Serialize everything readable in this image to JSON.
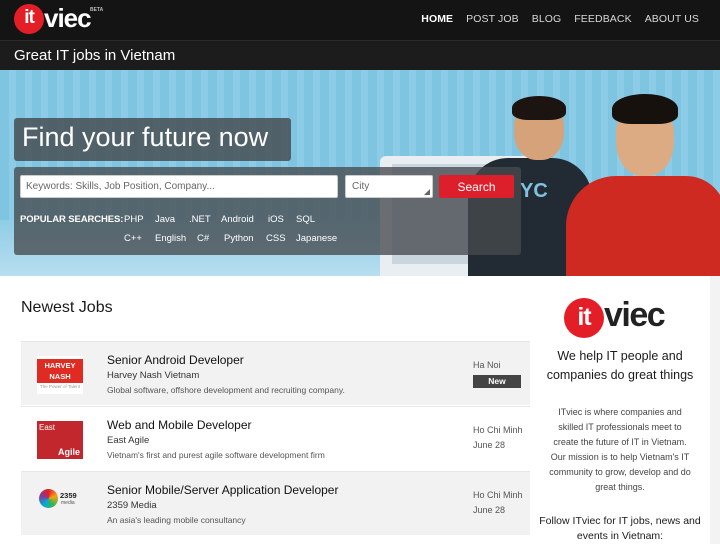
{
  "header": {
    "logo_it": "it",
    "logo_viec": "viec",
    "logo_beta": "BETA",
    "nav": [
      "HOME",
      "POST JOB",
      "BLOG",
      "FEEDBACK",
      "ABOUT US"
    ],
    "tagline": "Great IT jobs in Vietnam"
  },
  "hero": {
    "title": "Find your future now",
    "shirt_logo": "YC",
    "search": {
      "keywords_placeholder": "Keywords: Skills, Job Position, Company...",
      "city_value": "City",
      "button": "Search"
    },
    "popular_label": "POPULAR SEARCHES:",
    "popular_row1": [
      "PHP",
      "Java",
      ".NET",
      "Android",
      "iOS",
      "SQL"
    ],
    "popular_row2": [
      "C++",
      "English",
      "C#",
      "Python",
      "CSS",
      "Japanese"
    ]
  },
  "jobs": {
    "heading": "Newest Jobs",
    "items": [
      {
        "title": "Senior Android Developer",
        "company": "Harvey Nash Vietnam",
        "description": "Global software, offshore development and recruiting company.",
        "location": "Ha Noi",
        "badge": "New",
        "logo_line1": "HARVEY",
        "logo_line2": "NASH",
        "logo_sub": "The Power of Talent"
      },
      {
        "title": "Web and Mobile Developer",
        "company": "East Agile",
        "description": "Vietnam's first and purest agile software development firm",
        "location": "Ho Chi Minh",
        "date": "June 28",
        "logo_line1": "East",
        "logo_line2": "Agile"
      },
      {
        "title": "Senior Mobile/Server Application Developer",
        "company": "2359 Media",
        "description": "An asia's leading mobile consultancy",
        "location": "Ho Chi Minh",
        "date": "June 28",
        "logo_line1": "2359",
        "logo_line2": "media"
      }
    ]
  },
  "sidebar": {
    "logo_it": "it",
    "logo_viec": "viec",
    "tagline": "We help IT people and companies do great things",
    "body": "ITviec is where companies and skilled IT professionals meet to create the future of IT in Vietnam. Our mission is to help Vietnam's IT community to grow, develop and do great things.",
    "follow": "Follow ITviec for IT jobs, news and events in Vietnam:"
  },
  "colors": {
    "brand_red": "#e41e26",
    "search_red": "#dc1f2a",
    "topbar": "#141414",
    "hero_blue": "#7fc4e1"
  }
}
